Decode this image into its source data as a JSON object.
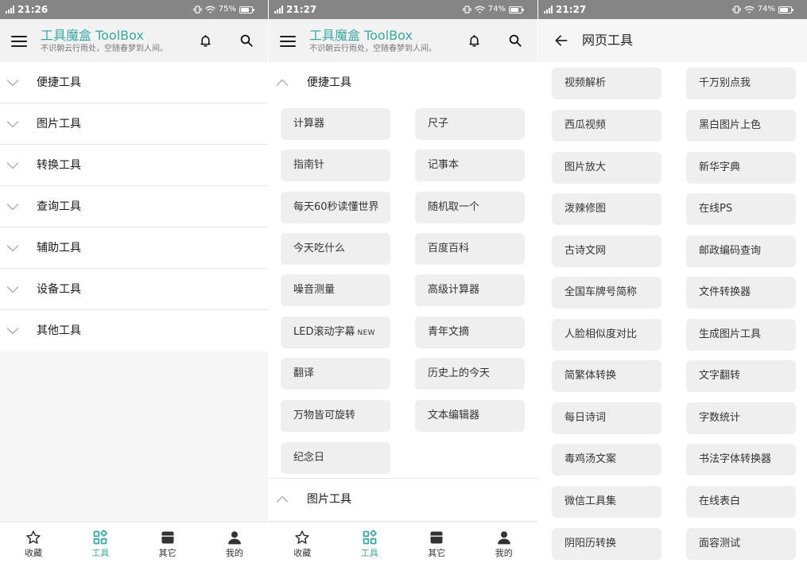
{
  "theme": {
    "accent": "#3aa8a1",
    "status_bar": "#858585",
    "tool_button_bg": "#efefef"
  },
  "screens": {
    "tools_home": {
      "status": {
        "time": "21:26",
        "battery": "75%"
      },
      "header": {
        "title": "工具魔盒 ToolBox",
        "subtitle": "不识朝云行雨处，空随春梦到人间。"
      },
      "categories": [
        "便捷工具",
        "图片工具",
        "转换工具",
        "查询工具",
        "辅助工具",
        "设备工具",
        "其他工具"
      ],
      "nav": [
        {
          "label": "收藏",
          "icon": "star-icon",
          "active": false
        },
        {
          "label": "工具",
          "icon": "grid-icon",
          "active": true
        },
        {
          "label": "其它",
          "icon": "box-icon",
          "active": false
        },
        {
          "label": "我的",
          "icon": "person-icon",
          "active": false
        }
      ]
    },
    "tools_expanded": {
      "status": {
        "time": "21:27",
        "battery": "74%"
      },
      "header": {
        "title": "工具魔盒 ToolBox",
        "subtitle": "不识朝云行雨处，空随春梦到人间。"
      },
      "expanded_category": "便捷工具",
      "tools": [
        {
          "label": "计算器"
        },
        {
          "label": "尺子"
        },
        {
          "label": "指南针"
        },
        {
          "label": "记事本"
        },
        {
          "label": "每天60秒读懂世界"
        },
        {
          "label": "随机取一个"
        },
        {
          "label": "今天吃什么"
        },
        {
          "label": "百度百科"
        },
        {
          "label": "噪音测量"
        },
        {
          "label": "高级计算器"
        },
        {
          "label": "LED滚动字幕",
          "badge": "NEW"
        },
        {
          "label": "青年文摘"
        },
        {
          "label": "翻译"
        },
        {
          "label": "历史上的今天"
        },
        {
          "label": "万物皆可旋转"
        },
        {
          "label": "文本编辑器"
        },
        {
          "label": "纪念日"
        }
      ],
      "next_category": "图片工具",
      "nav": [
        {
          "label": "收藏",
          "icon": "star-icon",
          "active": false
        },
        {
          "label": "工具",
          "icon": "grid-icon",
          "active": true
        },
        {
          "label": "其它",
          "icon": "box-icon",
          "active": false
        },
        {
          "label": "我的",
          "icon": "person-icon",
          "active": false
        }
      ]
    },
    "web_tools": {
      "status": {
        "time": "21:27",
        "battery": "74%"
      },
      "title": "网页工具",
      "tools": [
        "视频解析",
        "千万别点我",
        "西瓜视频",
        "黑白图片上色",
        "图片放大",
        "新华字典",
        "泼辣修图",
        "在线PS",
        "古诗文网",
        "邮政编码查询",
        "全国车牌号简称",
        "文件转换器",
        "人脸相似度对比",
        "生成图片工具",
        "简繁体转换",
        "文字翻转",
        "每日诗词",
        "字数统计",
        "毒鸡汤文案",
        "书法字体转换器",
        "微信工具集",
        "在线表白",
        "阴阳历转换",
        "面容测试"
      ]
    }
  }
}
